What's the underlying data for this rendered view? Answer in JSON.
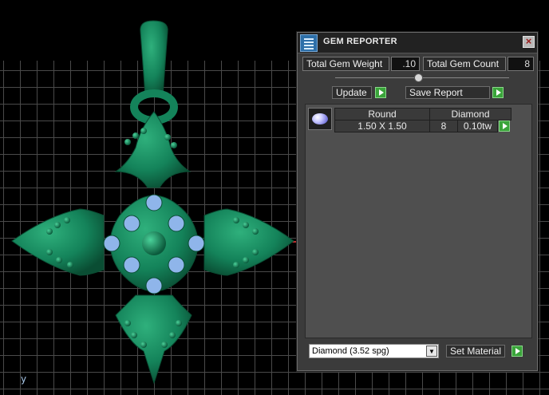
{
  "viewport": {
    "axis_label": "y"
  },
  "panel": {
    "title": "GEM REPORTER",
    "close_label": "×",
    "total_weight_label": "Total Gem Weight",
    "total_weight_value": ".10",
    "total_count_label": "Total Gem Count",
    "total_count_value": "8",
    "update_label": "Update",
    "save_report_label": "Save Report",
    "gem_list": [
      {
        "icon": "round-diamond-icon",
        "shape": "Round",
        "material": "Diamond",
        "size": "1.50 X 1.50",
        "count": "8",
        "weight": "0.10tw"
      }
    ],
    "material_select_value": "Diamond    (3.52 spg)",
    "set_material_label": "Set Material"
  },
  "colors": {
    "model": "#14835a",
    "model_dark": "#0b5a3c",
    "gem": "#8fb5ea",
    "accent_green": "#3aa43a"
  }
}
